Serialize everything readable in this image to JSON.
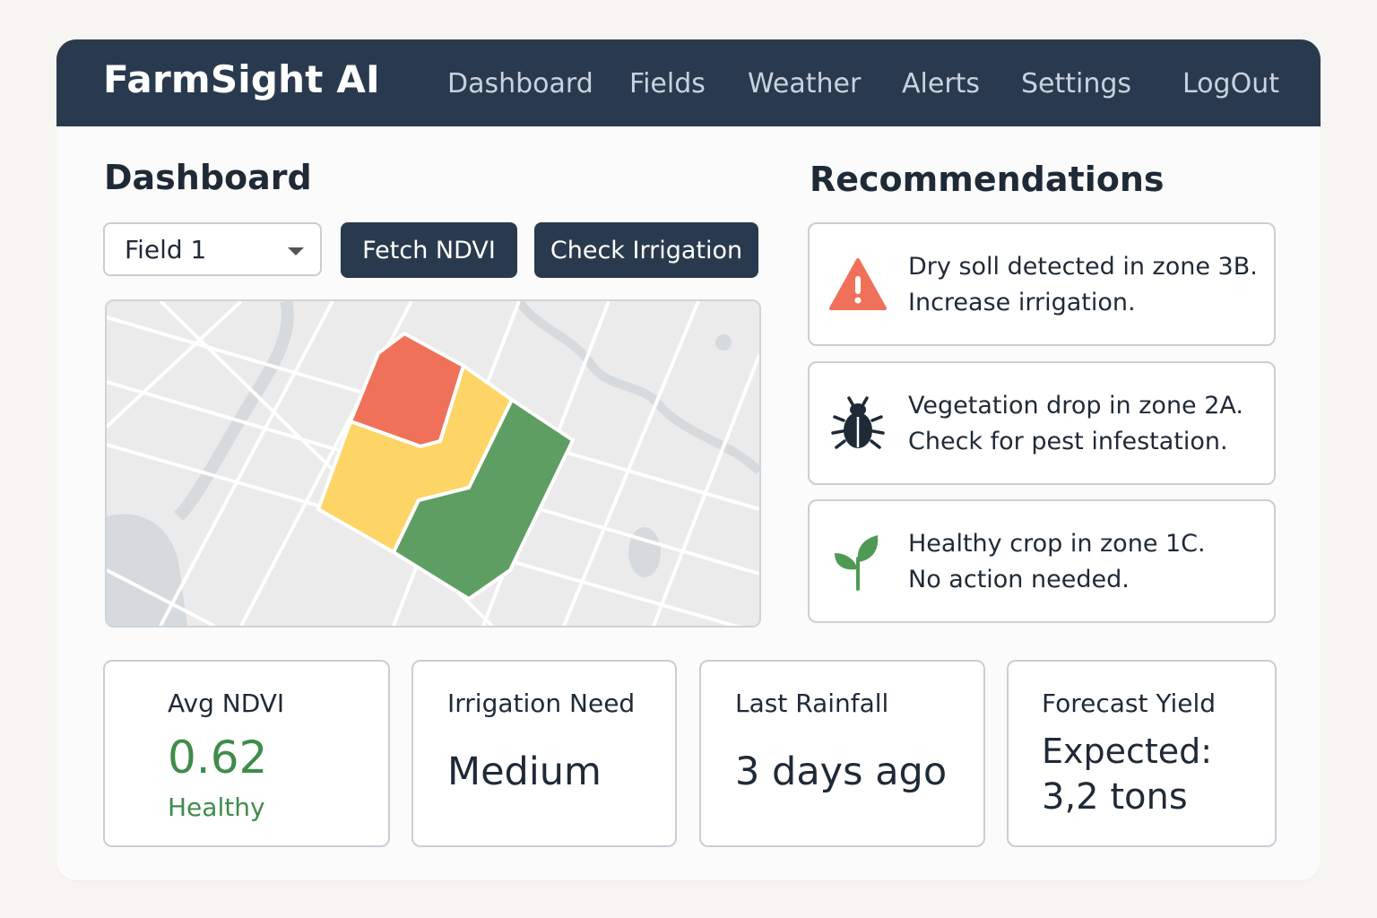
{
  "app": {
    "brand": "FarmSight AI"
  },
  "nav": {
    "dashboard": "Dashboard",
    "fields": "Fields",
    "weather": "Weather",
    "alerts": "Alerts",
    "settings": "Settings",
    "logout": "LogOut"
  },
  "dashboard": {
    "title": "Dashboard",
    "field_select": "Field 1",
    "fetch_button": "Fetch NDVI",
    "irrigation_button": "Check Irrigation"
  },
  "map": {
    "zone_colors": {
      "red": "#f0715a",
      "yellow": "#fdd566",
      "green": "#5e9e62"
    }
  },
  "recommendations": {
    "title": "Recommendations",
    "items": [
      {
        "icon": "warning-icon",
        "line1": "Dry soll detected in zone 3B.",
        "line2": "Increase irrigation.",
        "color": "#f0715a"
      },
      {
        "icon": "bug-icon",
        "line1": "Vegetation drop in zone 2A.",
        "line2": "Check for pest infestation.",
        "color": "#1f2a37"
      },
      {
        "icon": "sprout-icon",
        "line1": "Healthy crop in zone 1C.",
        "line2": "No action needed.",
        "color": "#4e9a55"
      }
    ]
  },
  "stats": {
    "ndvi": {
      "label": "Avg NDVI",
      "value": "0.62",
      "status": "Healthy"
    },
    "irrigation": {
      "label": "Irrigation Need",
      "value": "Medium"
    },
    "rainfall": {
      "label": "Last Rainfall",
      "value": "3 days ago"
    },
    "yield": {
      "label": "Forecast Yield",
      "line1": "Expected:",
      "line2": "3,2 tons"
    }
  },
  "colors": {
    "navbar": "#2a3a4e",
    "accent_green": "#3f8c4a"
  }
}
